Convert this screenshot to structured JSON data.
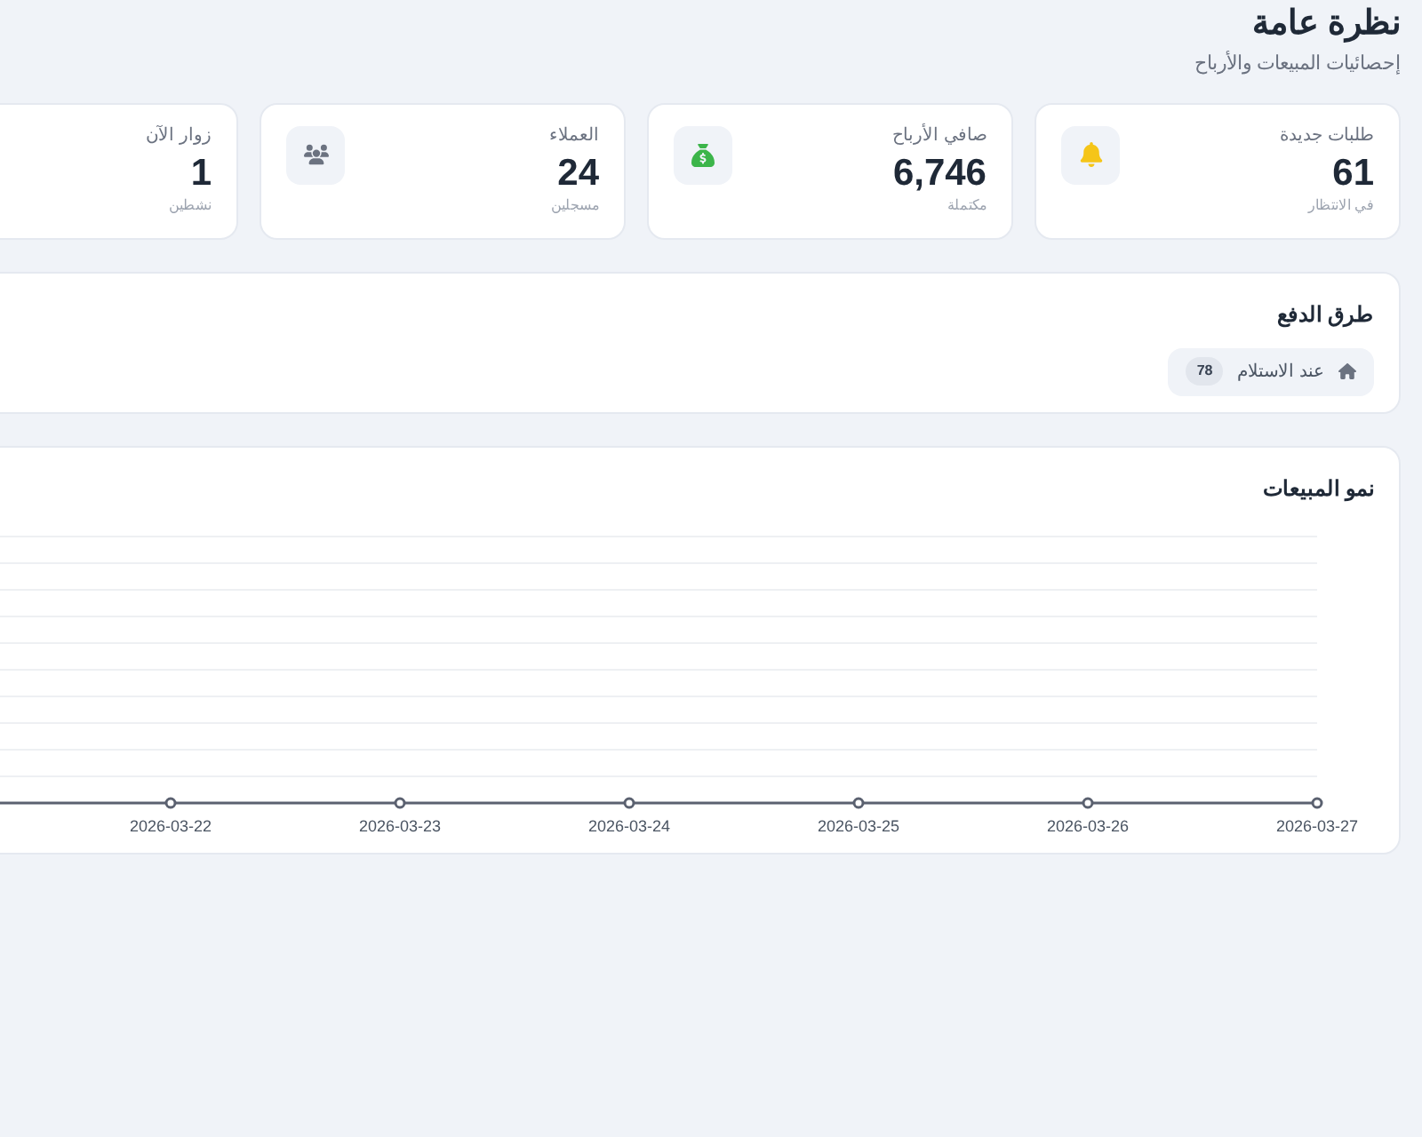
{
  "header": {
    "title": "نظرة عامة",
    "subtitle": "إحصائيات المبيعات والأرباح"
  },
  "stats": [
    {
      "kind": "orders",
      "label": "طلبات جديدة",
      "value": "61",
      "note": "في الانتظار"
    },
    {
      "kind": "profit",
      "label": "صافي الأرباح",
      "value": "6,746",
      "note": "مكتملة"
    },
    {
      "kind": "customers",
      "label": "العملاء",
      "value": "24",
      "note": "مسجلين"
    },
    {
      "kind": "visitors",
      "label": "زوار الآن",
      "value": "1",
      "note": "نشطين"
    }
  ],
  "payment_methods": {
    "title": "طرق الدفع",
    "items": [
      {
        "label": "عند الاستلام",
        "count": "78"
      }
    ]
  },
  "sales_growth": {
    "title": "نمو المبيعات",
    "x_labels": [
      "2026-03-27",
      "2026-03-26",
      "2026-03-25",
      "2026-03-24",
      "2026-03-23",
      "2026-03-22"
    ]
  }
}
